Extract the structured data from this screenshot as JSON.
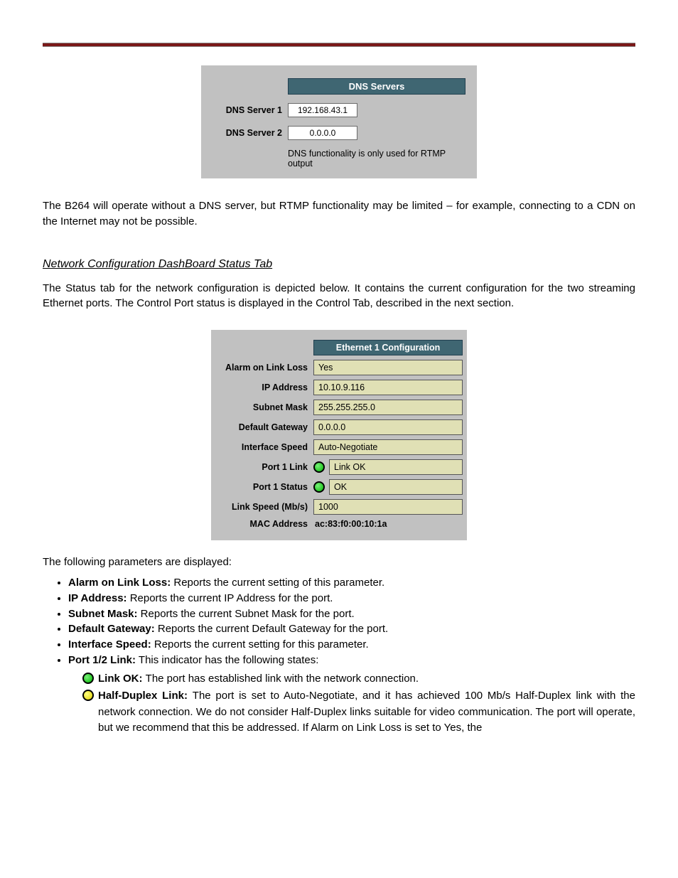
{
  "dns": {
    "header": "DNS Servers",
    "server1_label": "DNS Server 1",
    "server1_value": "192.168.43.1",
    "server2_label": "DNS Server 2",
    "server2_value": "0.0.0.0",
    "note": "DNS functionality is only used for RTMP output"
  },
  "intro": {
    "paragraph": "The B264 will operate without a DNS server, but RTMP functionality may be limited – for example, connecting to a CDN on the Internet may not be possible.",
    "heading": "Network Configuration DashBoard Status Tab",
    "status_para": "The Status tab for the network configuration is depicted below. It contains the current configuration for the two streaming Ethernet ports. The Control Port status is displayed in the Control Tab, described in the next section."
  },
  "eth": {
    "header": "Ethernet 1 Configuration",
    "alarm_label": "Alarm on Link Loss",
    "alarm_value": "Yes",
    "ip_label": "IP Address",
    "ip_value": "10.10.9.116",
    "mask_label": "Subnet Mask",
    "mask_value": "255.255.255.0",
    "gw_label": "Default Gateway",
    "gw_value": "0.0.0.0",
    "speed_label": "Interface Speed",
    "speed_value": "Auto-Negotiate",
    "link_label": "Port 1 Link",
    "link_value": "Link OK",
    "status_label": "Port 1 Status",
    "status_value": "OK",
    "linkspeed_label": "Link Speed (Mb/s)",
    "linkspeed_value": "1000",
    "mac_label": "MAC Address",
    "mac_value": "ac:83:f0:00:10:1a"
  },
  "params": {
    "intro": "The following parameters are displayed:",
    "alarm_b": "Alarm on Link Loss:",
    "alarm_t": " Reports the current setting of this parameter.",
    "ip_b": "IP Address:",
    "ip_t": " Reports the current IP Address for the port.",
    "mask_b": "Subnet Mask:",
    "mask_t": " Reports the current Subnet Mask for the port.",
    "gw_b": "Default Gateway:",
    "gw_t": " Reports the current Default Gateway for the port.",
    "speed_b": "Interface Speed:",
    "speed_t": " Reports the current setting for this parameter.",
    "plink_b": "Port 1/2 Link:",
    "plink_t": " This indicator has the following states:",
    "ind_ok_b": "Link OK: ",
    "ind_ok_t": "The port has established link with the network connection.",
    "ind_half_b": "Half-Duplex Link: ",
    "ind_half_t": "The port is set to Auto-Negotiate, and it has achieved 100 Mb/s Half-Duplex link with the network connection. We do not consider Half-Duplex links suitable for video communication. The port will operate, but we recommend that this be addressed. If Alarm on Link Loss is set to Yes, the"
  }
}
